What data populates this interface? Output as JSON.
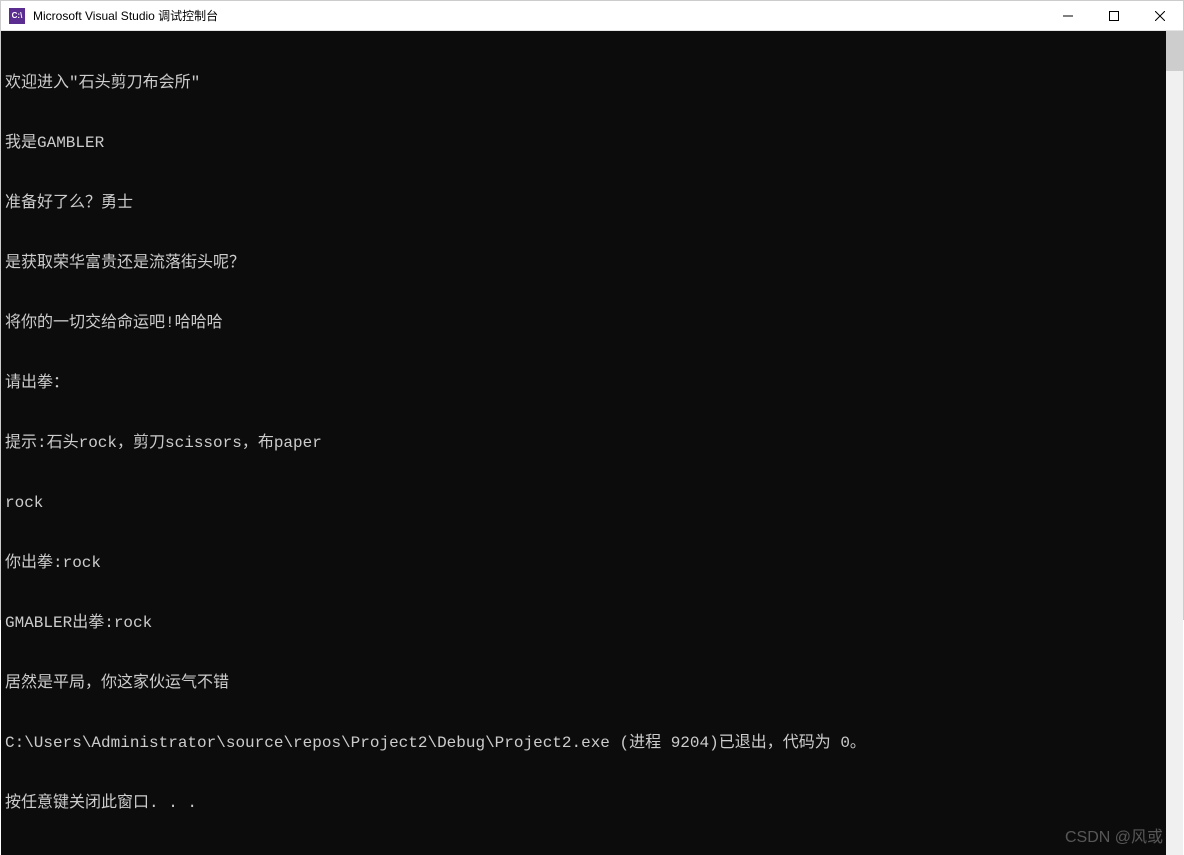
{
  "window": {
    "icon_text": "C:\\",
    "title": "Microsoft Visual Studio 调试控制台"
  },
  "console": {
    "lines": [
      "欢迎进入\"石头剪刀布会所\"",
      "我是GAMBLER",
      "准备好了么？勇士",
      "是获取荣华富贵还是流落街头呢？",
      "将你的一切交给命运吧!哈哈哈",
      "请出拳：",
      "提示:石头rock，剪刀scissors，布paper",
      "rock",
      "你出拳:rock",
      "GMABLER出拳:rock",
      "居然是平局，你这家伙运气不错",
      "C:\\Users\\Administrator\\source\\repos\\Project2\\Debug\\Project2.exe (进程 9204)已退出，代码为 0。",
      "按任意键关闭此窗口. . ."
    ]
  },
  "watermark": "CSDN @风或"
}
